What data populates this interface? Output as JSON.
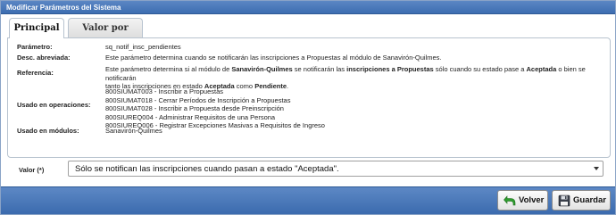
{
  "window": {
    "title": "Modificar Parámetros del Sistema"
  },
  "tabs": [
    {
      "label": "Principal",
      "active": true
    },
    {
      "label": "Valor por Nivel",
      "active": false
    }
  ],
  "fields": {
    "parametro": {
      "label": "Parámetro:",
      "value": "sq_notif_insc_pendientes"
    },
    "desc": {
      "label": "Desc. abreviada:",
      "value": "Este parámetro determina cuando se notificarán las inscripciones a Propuestas al módulo de Sanavirón-Quilmes."
    },
    "referencia": {
      "label": "Referencia:",
      "t1": "Este parámetro determina si al módulo de ",
      "b1": "Sanavirón-Quilmes",
      "t2": " se notificarán las ",
      "b2": "inscripciones a Propuestas",
      "t3": " sólo cuando su estado pase a ",
      "b3": "Aceptada",
      "t4": " o bien se notificarán",
      "t5": "tanto las inscripciones en estado ",
      "b4": "Aceptada",
      "t6": " como ",
      "b5": "Pendiente",
      "t7": "."
    },
    "operaciones": {
      "label": "Usado en operaciones:",
      "items": [
        "800SIUMAT003 - Inscribir a Propuestas",
        "800SIUMAT018 - Cerrar Períodos de Inscripción a Propuestas",
        "800SIUMAT028 - Inscribir a Propuesta desde Preinscripción",
        "800SIUREQ004 - Administrar Requisitos de una Persona",
        "800SIUREQ006 - Registrar Excepciones Masivas a Requisitos de Ingreso"
      ]
    },
    "modulos": {
      "label": "Usado en módulos:",
      "value": "Sanavirón-Quilmes"
    }
  },
  "valor": {
    "label": "Valor (*)",
    "selected": "Sólo se notifican las inscripciones cuando pasan a estado \"Aceptada\"."
  },
  "buttons": {
    "volver": "Volver",
    "guardar": "Guardar"
  },
  "colors": {
    "bar": "#4777b8",
    "tab_border": "#b8c3cf"
  },
  "icons": {
    "volver": "green-back-arrow-icon",
    "guardar": "floppy-disk-icon"
  }
}
